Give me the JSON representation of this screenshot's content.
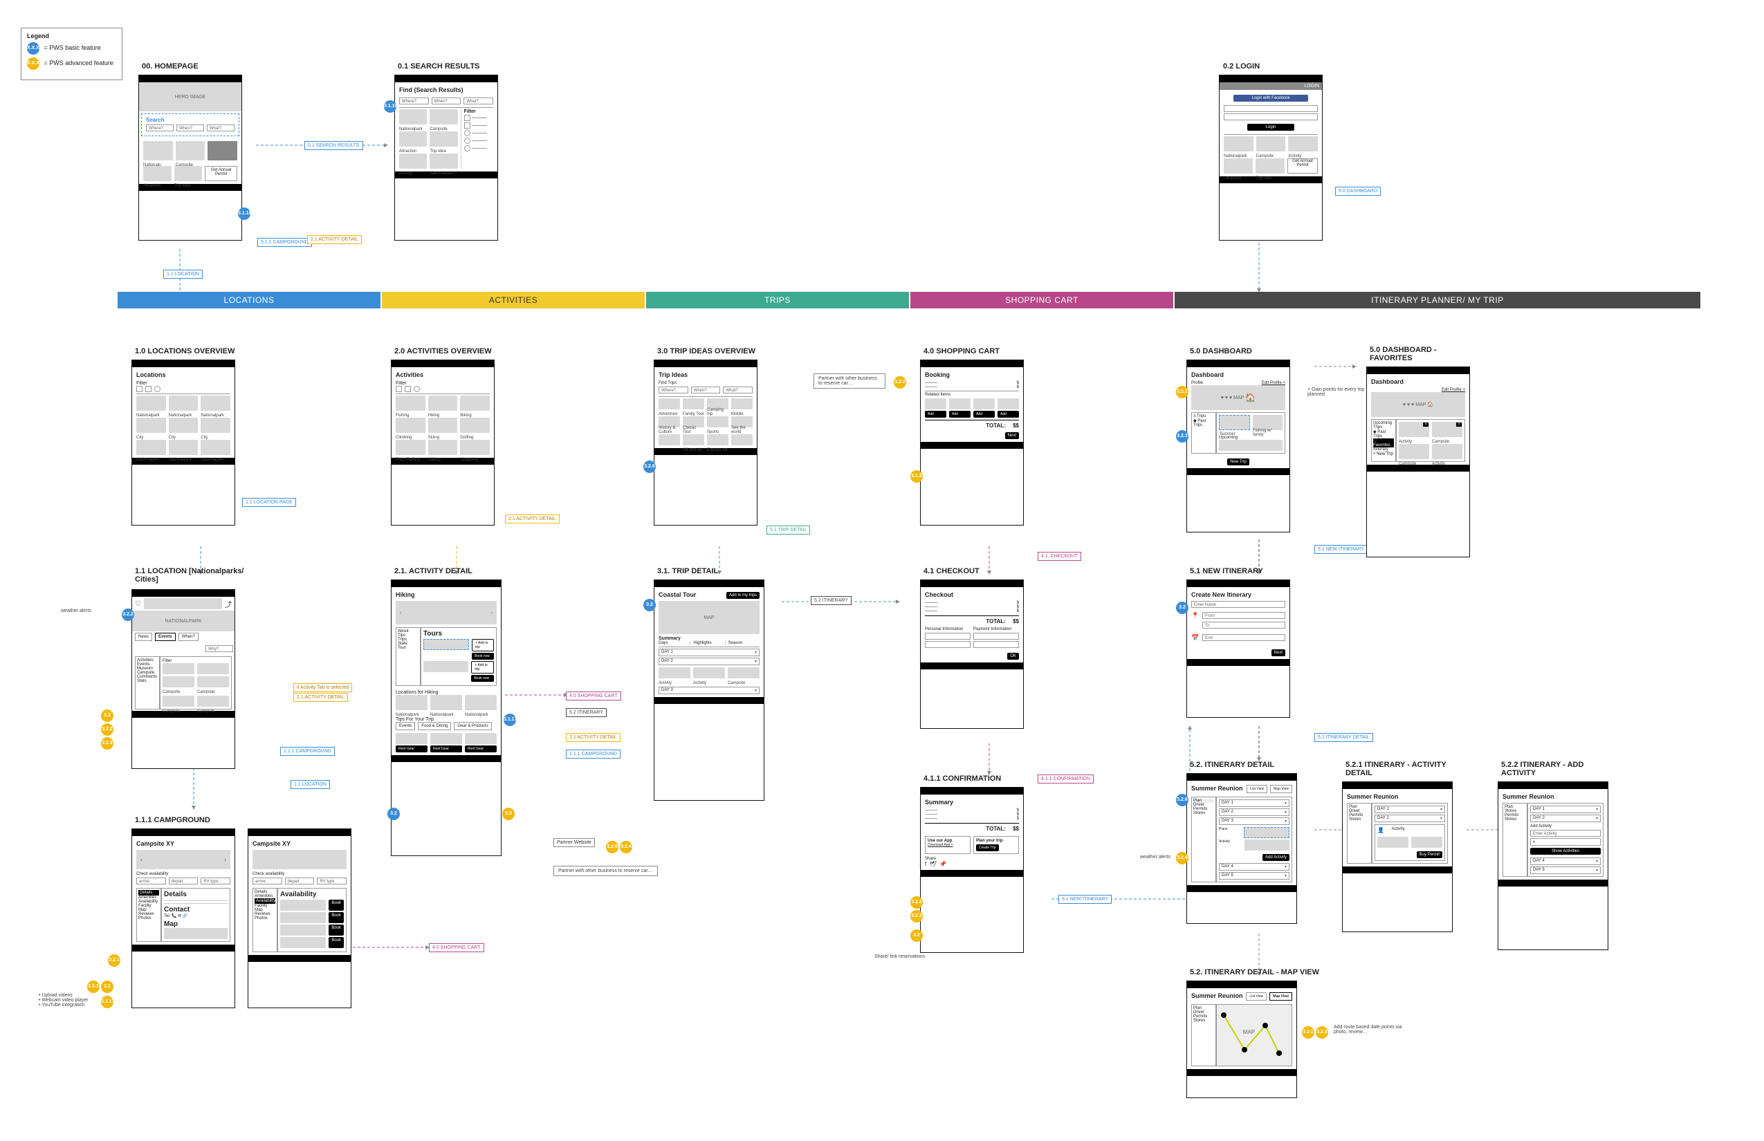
{
  "legend": {
    "title": "Legend",
    "basic_dot": "X.X.X",
    "basic_label": "= PWS basic feature",
    "adv_dot": "X.X.X",
    "adv_label": "= PWS advanced feature"
  },
  "lanes": {
    "locations": "LOCATIONS",
    "activities": "ACTIVITIES",
    "trips": "TRIPS",
    "cart": "SHOPPING CART",
    "itin": "ITINERARY PLANNER/ MY TRIP"
  },
  "titles": {
    "home": "00. HOMEPAGE",
    "search": "0.1 SEARCH RESULTS",
    "login": "0.2 LOGIN",
    "loc_ov": "1.0 LOCATIONS OVERVIEW",
    "loc_detail": "1.1 LOCATION [Nationalparks/ Cities]",
    "camp": "1.1.1 CAMPGROUND",
    "act_ov": "2.0 ACTIVITIES OVERVIEW",
    "act_detail": "2.1. ACTIVITY DETAIL",
    "trip_ov": "3.0 TRIP IDEAS OVERVIEW",
    "trip_detail": "3.1. TRIP DETAIL",
    "cart": "4.0 SHOPPING CART",
    "checkout": "4.1 CHECKOUT",
    "confirm": "4.1.1 CONFIRMATION",
    "dash": "5.0 DASHBOARD",
    "dash_fav": "5.0 DASHBOARD - FAVORITES",
    "new_itin": "5.1 NEW ITINERARY",
    "itin_detail": "5.2. ITINERARY DETAIL",
    "itin_act": "5.2.1 ITINERARY - ACTIVITY DETAIL",
    "itin_add": "5.2.2 ITINERARY - ADD ACTIVITY",
    "itin_map": "5.2. ITINERARY DETAIL - MAP VIEW"
  },
  "home": {
    "hero": "HERO IMAGE",
    "search": "Search",
    "where": "Where?",
    "when": "When?",
    "what": "What?",
    "tiles": [
      "Nationalp.",
      "Campsite"
    ],
    "tiles2": [
      "Attraction",
      "Trip Idea"
    ],
    "permit": "Get Annual Permit"
  },
  "search": {
    "title": "Find (Search Results)",
    "where": "Where?",
    "when": "When?",
    "what": "What?",
    "filter": "Filter",
    "tiles": [
      "Nationalpark",
      "Campsite"
    ],
    "tiles2": [
      "Attraction",
      "Trip Idea"
    ],
    "tiles3": [
      "Activity",
      "Nationalpark"
    ]
  },
  "login": {
    "btn_fb": "Login with Facebook",
    "btn_login": "Login",
    "tiles": [
      "Nationalpark",
      "Campsite",
      "Activity"
    ],
    "tiles2": [
      "Attraction",
      "Trip Idea"
    ],
    "permit": "Get Annual Permit",
    "header": "LOGIN"
  },
  "locov": {
    "title": "Locations",
    "filter": "Filter",
    "row1": [
      "Nationalpark",
      "Nationalpark",
      "Nationalpark"
    ],
    "row2": [
      "City",
      "City",
      "City"
    ],
    "row3": [
      "Nationalpark",
      "Nationalpark",
      "Nationalpark"
    ]
  },
  "locdetail": {
    "title": "NATIONALPARK",
    "tabs": [
      "News",
      "Events",
      "When?"
    ],
    "side": [
      "Activities",
      "Events",
      "Museum",
      "Campsite",
      "Comments",
      "Stats"
    ],
    "filter": "Filter",
    "cells": [
      "Campsite",
      "Campsite",
      "Campsite",
      "Campsite"
    ],
    "crumb_why": "Why?"
  },
  "camp": {
    "title": "Campsite XY",
    "check": "Check availability",
    "arr": "arrive",
    "dep": "depart",
    "rv": "RV type",
    "tabs": [
      "Details",
      "Amenities",
      "Availability",
      "Facility Map",
      "Reviews",
      "Photos"
    ],
    "details": "Details",
    "contact": "Contact",
    "tel": "Tel:",
    "map": "Map",
    "avail": "Availability",
    "book": "Book"
  },
  "actov": {
    "title": "Activities",
    "filter": "Filter",
    "row1": [
      "Fishing",
      "Hiking",
      "Biking"
    ],
    "row2": [
      "Climbing",
      "Skiing",
      "Golfing"
    ],
    "row3": [
      "River\nRafting",
      "Sailing",
      "Shopping"
    ]
  },
  "actdetail": {
    "title": "Hiking",
    "side": [
      "About",
      "Tips",
      "Trips",
      "State",
      "Tour"
    ],
    "tours": "Tours",
    "add_trip": "+ Add to trip",
    "booknow": "Book now",
    "tips": "Tips For Your Trip",
    "tip_items": [
      "Events",
      "Food & Dining",
      "Gear & Products"
    ],
    "rent": "Rent Gear",
    "loc_for": "Locations for Hiking",
    "tiles": [
      "Nationalpark",
      "Nationalpark",
      "Nationalpark"
    ]
  },
  "tripov": {
    "title": "Trip Ideas",
    "find": "Find Trips",
    "where": "Where?",
    "when": "When?",
    "what": "What?",
    "row1": [
      "Adventure",
      "Family Tour",
      "Camping trip",
      "Mobile"
    ],
    "row2": [
      "History & Culture",
      "Classic Tour",
      "Sports",
      "See the world"
    ],
    "row3": [
      "Off into Air",
      "Explore Art"
    ]
  },
  "tripdetail": {
    "title": "Coastal Tour",
    "add": "Add to my trips",
    "map": "MAP",
    "summary": "Summary",
    "cols": [
      "Days",
      "Highlights",
      "Season"
    ],
    "day1": "DAY 1",
    "day2": "DAY 2",
    "day3": "DAY 3",
    "cells": [
      "Activity",
      "Activity",
      "Campsite"
    ]
  },
  "cart": {
    "title": "Booking",
    "related": "Related Items",
    "add": "Add",
    "total": "TOTAL:",
    "amount": "$$",
    "next": "Next"
  },
  "checkout": {
    "title": "Checkout",
    "total": "TOTAL:",
    "amount": "$$",
    "pi": "Personal Information",
    "pay": "Payment Information",
    "ok": "OK"
  },
  "confirm": {
    "title": "Summary",
    "total": "TOTAL:",
    "amount": "$$",
    "app": "Use our App",
    "plan": "Plan your trip",
    "dl": "Download App >",
    "create": "Create Trip",
    "share": "Share"
  },
  "dash": {
    "title": "Dashboard",
    "profile": "Profile",
    "edit": "Edit Profile >",
    "map": "MAP",
    "tabs_side": [
      "≡ Trips",
      "◆ Past Trips"
    ],
    "tiles": [
      "Summer",
      "Fishing w/ family"
    ],
    "upcoming": "Upcoming",
    "newtrip": "New Trip"
  },
  "dashfav": {
    "title": "Dashboard",
    "edit": "Edit Profile >",
    "map": "MAP",
    "side": [
      "Upcoming Trips",
      "◆ Past Trips",
      "♡ Favorites",
      "Itinerary"
    ],
    "newtrip": "+ New Trip",
    "tile_a": "Activity",
    "tile_b": "Campsite",
    "bottom": [
      "Campsite",
      "Activity"
    ]
  },
  "newitin": {
    "title": "Create New Itinerary",
    "name": "Enter Name",
    "from": "From",
    "to": "To",
    "end": "End",
    "next": "Next"
  },
  "itindetail": {
    "title": "Summer Reunion",
    "tabs": [
      "List View",
      "Map View"
    ],
    "side": [
      "Plan",
      "Driver",
      "Permits",
      "Stores"
    ],
    "day1": "DAY 1",
    "day2": "DAY 2",
    "day3": "DAY 3",
    "day4": "DAY 4",
    "day5": "DAY 5",
    "place": "Place",
    "act": "Activity",
    "add": "Add Activity"
  },
  "itinact": {
    "title": "Summer Reunion",
    "side": [
      "Plan",
      "Driver",
      "Permits",
      "Stores"
    ],
    "day1": "DAY 1",
    "day2": "DAY 2",
    "act": "Activity",
    "buy": "Buy Permit"
  },
  "itinadd": {
    "title": "Summer Reunion",
    "side": [
      "Plan",
      "Stores",
      "Permits",
      "Stores"
    ],
    "day1": "DAY 1",
    "day2": "DAY 2",
    "day4": "DAY 4",
    "day5": "DAY 5",
    "add": "Add Activity",
    "enter": "Enter Activity",
    "show": "Show Activities"
  },
  "itinmap": {
    "title": "Summer Reunion",
    "tabs": [
      "List View",
      "Map View"
    ],
    "side": [
      "Plan",
      "Driver",
      "Permits",
      "Stores"
    ],
    "map": "MAP"
  },
  "annos": {
    "a1": "0.1 SEARCH RESULTS",
    "a2": "5.1.1 CAMPGROUND",
    "a3": "2.1 ACTIVITY DETAIL",
    "a4": "1.1 LOCATION",
    "a5": "1.1 LOCATION PAGE",
    "a6": "2.1 ACTIVITY DETAIL",
    "a7": "if Activity Tab is selected",
    "a8": "2.1 ACTIVITY DETAIL",
    "a9": "1.1.1 CAMPGROUND",
    "a10": "1.1 LOCATION",
    "a11": "4.0 SHOPPING CART",
    "a12": "5.2 ITINERARY",
    "a13": "2.1 ACTIVITY DETAIL",
    "a14": "1.1.1 CAMPGROUND",
    "a15": "5.1 TRIP DETAIL",
    "a16": "5.2 ITINERARY",
    "a17": "4.1. CHECKOUT",
    "a18": "Partner with other business to reserve car…",
    "a19": "4.1.1 CONFIRMATION",
    "a20": "5.1 NEW ITINERARY",
    "a21": "Share/ link reservations",
    "a22": "5.0 DASHBOARD",
    "a23": "5.1 NEW ITINERARY",
    "a24": "5.2 ITINERARY DETAIL",
    "a25": "+ Gain points for every trip planned",
    "a26": "weather alerts",
    "a27": "Add route based date points via photo, review…",
    "a28": "Partner Website",
    "a29": "4.0 SHOPPING CART",
    "a30": "Partner with other business to reserve car…",
    "a31": "• Upload videos\n• Webcam video player\n• YouTube integration"
  },
  "dots": {
    "d1": "3.1.18",
    "d2": "3.1.19",
    "d3": "3.2.2",
    "d4": "3.2",
    "d5": "3.2.2",
    "d6": "3.2.2",
    "d7": "3.2.1",
    "d8": "3.3.3",
    "d9": "3.1",
    "d10": "3.2.17",
    "d11": "3.1.17",
    "d12": "3.2",
    "d13": "3.3",
    "d14": "3.2.6",
    "d15": "3.2.4",
    "d16": "3.2.6",
    "d17": "3.2",
    "d18": "3.2.2",
    "d19": "3.1.2",
    "d20": "3.2.2",
    "d21": "3.2.3",
    "d22": "3.2",
    "d23": "3.2.1",
    "d24": "3.2.3"
  }
}
